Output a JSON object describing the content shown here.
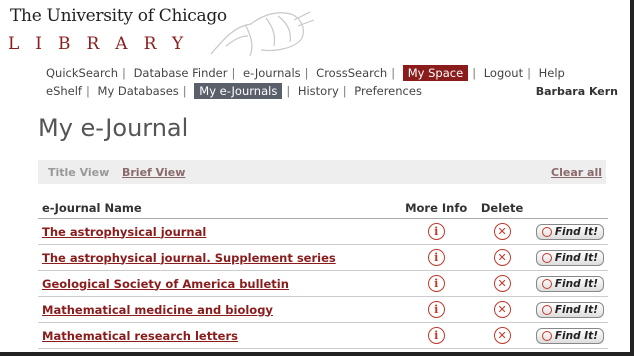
{
  "header": {
    "university": "The University of Chicago",
    "library": "LIBRARY"
  },
  "nav_primary": [
    {
      "label": "QuickSearch",
      "active": false
    },
    {
      "label": "Database Finder",
      "active": false
    },
    {
      "label": "e-Journals",
      "active": false
    },
    {
      "label": "CrossSearch",
      "active": false
    },
    {
      "label": "My Space",
      "active": true
    },
    {
      "label": "Logout",
      "active": false
    },
    {
      "label": "Help",
      "active": false
    }
  ],
  "nav_secondary": [
    {
      "label": "eShelf",
      "active": false
    },
    {
      "label": "My Databases",
      "active": false
    },
    {
      "label": "My e-Journals",
      "active": true
    },
    {
      "label": "History",
      "active": false
    },
    {
      "label": "Preferences",
      "active": false
    }
  ],
  "user_name": "Barbara Kern",
  "page_title": "My e-Journal",
  "view_bar": {
    "title_view": "Title View",
    "brief_view": "Brief View",
    "clear_all": "Clear all"
  },
  "table": {
    "headers": {
      "name": "e-Journal Name",
      "more_info": "More Info",
      "delete": "Delete"
    },
    "find_it_label": "Find It!",
    "rows": [
      {
        "name": "The astrophysical journal"
      },
      {
        "name": "The astrophysical journal. Supplement series"
      },
      {
        "name": "Geological Society of America bulletin"
      },
      {
        "name": "Mathematical medicine and biology"
      },
      {
        "name": "Mathematical research letters"
      }
    ]
  },
  "colors": {
    "brand_red": "#8a1c1c",
    "active_grey": "#59606a",
    "icon_red": "#c0392b"
  }
}
